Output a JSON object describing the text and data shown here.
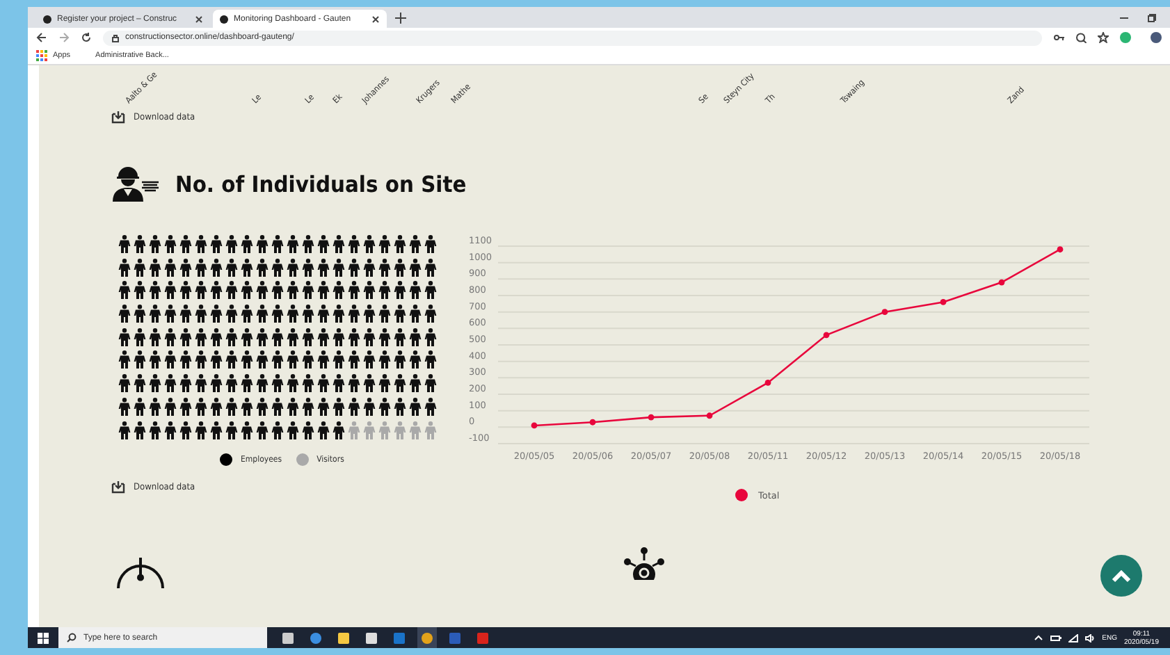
{
  "browser": {
    "tabs": [
      {
        "title": "Register your project – Construc",
        "selected": false
      },
      {
        "title": "Monitoring Dashboard - Gauten",
        "selected": true
      }
    ],
    "url": "constructionsector.online/dashboard-gauteng/",
    "bookmarks": [
      "Apps",
      "Administrative Back..."
    ]
  },
  "top_axis_labels": [
    "Aalto & Ge",
    "Le",
    "Le",
    "Ek",
    "Johannes",
    "Krugers",
    "Mathe",
    "Se",
    "Steyn City",
    "Th",
    "Tswaing",
    "Zand"
  ],
  "download_top": "Download data",
  "section_title": "No. of Individuals on Site",
  "waffle": {
    "rows": [
      {
        "figures": [
          {
            "kind": "employee"
          },
          {
            "kind": "employee"
          },
          {
            "kind": "employee"
          },
          {
            "kind": "employee"
          },
          {
            "kind": "employee"
          },
          {
            "kind": "employee"
          },
          {
            "kind": "employee"
          },
          {
            "kind": "employee"
          },
          {
            "kind": "employee"
          },
          {
            "kind": "employee"
          },
          {
            "kind": "employee"
          },
          {
            "kind": "employee"
          },
          {
            "kind": "employee"
          },
          {
            "kind": "employee"
          },
          {
            "kind": "employee"
          },
          {
            "kind": "employee"
          },
          {
            "kind": "employee"
          },
          {
            "kind": "employee"
          },
          {
            "kind": "employee"
          },
          {
            "kind": "employee"
          },
          {
            "kind": "employee"
          }
        ]
      },
      {
        "figures": [
          {
            "kind": "employee"
          },
          {
            "kind": "employee"
          },
          {
            "kind": "employee"
          },
          {
            "kind": "employee"
          },
          {
            "kind": "employee"
          },
          {
            "kind": "employee"
          },
          {
            "kind": "employee"
          },
          {
            "kind": "employee"
          },
          {
            "kind": "employee"
          },
          {
            "kind": "employee"
          },
          {
            "kind": "employee"
          },
          {
            "kind": "employee"
          },
          {
            "kind": "employee"
          },
          {
            "kind": "employee"
          },
          {
            "kind": "employee"
          },
          {
            "kind": "employee"
          },
          {
            "kind": "employee"
          },
          {
            "kind": "employee"
          },
          {
            "kind": "employee"
          },
          {
            "kind": "employee"
          },
          {
            "kind": "employee"
          }
        ]
      },
      {
        "figures": [
          {
            "kind": "employee"
          },
          {
            "kind": "employee"
          },
          {
            "kind": "employee"
          },
          {
            "kind": "employee"
          },
          {
            "kind": "employee"
          },
          {
            "kind": "employee"
          },
          {
            "kind": "employee"
          },
          {
            "kind": "employee"
          },
          {
            "kind": "employee"
          },
          {
            "kind": "employee"
          },
          {
            "kind": "employee"
          },
          {
            "kind": "employee"
          },
          {
            "kind": "employee"
          },
          {
            "kind": "employee"
          },
          {
            "kind": "employee"
          },
          {
            "kind": "employee"
          },
          {
            "kind": "employee"
          },
          {
            "kind": "employee"
          },
          {
            "kind": "employee"
          },
          {
            "kind": "employee"
          },
          {
            "kind": "employee"
          }
        ]
      },
      {
        "figures": [
          {
            "kind": "employee"
          },
          {
            "kind": "employee"
          },
          {
            "kind": "employee"
          },
          {
            "kind": "employee"
          },
          {
            "kind": "employee"
          },
          {
            "kind": "employee"
          },
          {
            "kind": "employee"
          },
          {
            "kind": "employee"
          },
          {
            "kind": "employee"
          },
          {
            "kind": "employee"
          },
          {
            "kind": "employee"
          },
          {
            "kind": "employee"
          },
          {
            "kind": "employee"
          },
          {
            "kind": "employee"
          },
          {
            "kind": "employee"
          },
          {
            "kind": "employee"
          },
          {
            "kind": "employee"
          },
          {
            "kind": "employee"
          },
          {
            "kind": "employee"
          },
          {
            "kind": "employee"
          },
          {
            "kind": "employee"
          }
        ]
      },
      {
        "figures": [
          {
            "kind": "employee"
          },
          {
            "kind": "employee"
          },
          {
            "kind": "employee"
          },
          {
            "kind": "employee"
          },
          {
            "kind": "employee"
          },
          {
            "kind": "employee"
          },
          {
            "kind": "employee"
          },
          {
            "kind": "employee"
          },
          {
            "kind": "employee"
          },
          {
            "kind": "employee"
          },
          {
            "kind": "employee"
          },
          {
            "kind": "employee"
          },
          {
            "kind": "employee"
          },
          {
            "kind": "employee"
          },
          {
            "kind": "employee"
          },
          {
            "kind": "employee"
          },
          {
            "kind": "employee"
          },
          {
            "kind": "employee"
          },
          {
            "kind": "employee"
          },
          {
            "kind": "employee"
          },
          {
            "kind": "employee"
          }
        ]
      },
      {
        "figures": [
          {
            "kind": "employee"
          },
          {
            "kind": "employee"
          },
          {
            "kind": "employee"
          },
          {
            "kind": "employee"
          },
          {
            "kind": "employee"
          },
          {
            "kind": "employee"
          },
          {
            "kind": "employee"
          },
          {
            "kind": "employee"
          },
          {
            "kind": "employee"
          },
          {
            "kind": "employee"
          },
          {
            "kind": "employee"
          },
          {
            "kind": "employee"
          },
          {
            "kind": "employee"
          },
          {
            "kind": "employee"
          },
          {
            "kind": "employee"
          },
          {
            "kind": "employee"
          },
          {
            "kind": "employee"
          },
          {
            "kind": "employee"
          },
          {
            "kind": "employee"
          },
          {
            "kind": "employee"
          },
          {
            "kind": "employee"
          }
        ]
      },
      {
        "figures": [
          {
            "kind": "employee"
          },
          {
            "kind": "employee"
          },
          {
            "kind": "employee"
          },
          {
            "kind": "employee"
          },
          {
            "kind": "employee"
          },
          {
            "kind": "employee"
          },
          {
            "kind": "employee"
          },
          {
            "kind": "employee"
          },
          {
            "kind": "employee"
          },
          {
            "kind": "employee"
          },
          {
            "kind": "employee"
          },
          {
            "kind": "employee"
          },
          {
            "kind": "employee"
          },
          {
            "kind": "employee"
          },
          {
            "kind": "employee"
          },
          {
            "kind": "employee"
          },
          {
            "kind": "employee"
          },
          {
            "kind": "employee"
          },
          {
            "kind": "employee"
          },
          {
            "kind": "employee"
          },
          {
            "kind": "employee"
          }
        ]
      },
      {
        "figures": [
          {
            "kind": "employee"
          },
          {
            "kind": "employee"
          },
          {
            "kind": "employee"
          },
          {
            "kind": "employee"
          },
          {
            "kind": "employee"
          },
          {
            "kind": "employee"
          },
          {
            "kind": "employee"
          },
          {
            "kind": "employee"
          },
          {
            "kind": "employee"
          },
          {
            "kind": "employee"
          },
          {
            "kind": "employee"
          },
          {
            "kind": "employee"
          },
          {
            "kind": "employee"
          },
          {
            "kind": "employee"
          },
          {
            "kind": "employee"
          },
          {
            "kind": "employee"
          },
          {
            "kind": "employee"
          },
          {
            "kind": "employee"
          },
          {
            "kind": "employee"
          },
          {
            "kind": "employee"
          },
          {
            "kind": "employee"
          }
        ]
      },
      {
        "figures": [
          {
            "kind": "employee"
          },
          {
            "kind": "employee"
          },
          {
            "kind": "employee"
          },
          {
            "kind": "employee"
          },
          {
            "kind": "employee"
          },
          {
            "kind": "employee"
          },
          {
            "kind": "employee"
          },
          {
            "kind": "employee"
          },
          {
            "kind": "employee"
          },
          {
            "kind": "employee"
          },
          {
            "kind": "employee"
          },
          {
            "kind": "employee"
          },
          {
            "kind": "employee"
          },
          {
            "kind": "employee"
          },
          {
            "kind": "employee"
          },
          {
            "kind": "visitor"
          },
          {
            "kind": "visitor"
          },
          {
            "kind": "visitor"
          },
          {
            "kind": "visitor"
          },
          {
            "kind": "visitor"
          },
          {
            "kind": "visitor"
          }
        ]
      }
    ],
    "legend": [
      {
        "label": "Employees",
        "color": "#000000"
      },
      {
        "label": "Visitors",
        "color": "#a9a9a9"
      }
    ]
  },
  "download_bottom": "Download data",
  "chart_data": {
    "type": "line",
    "categories": [
      "20/05/05",
      "20/05/06",
      "20/05/07",
      "20/05/08",
      "20/05/11",
      "20/05/12",
      "20/05/13",
      "20/05/14",
      "20/05/15",
      "20/05/18"
    ],
    "series": [
      {
        "name": "Total",
        "color": "#e8063c",
        "marker": "circle",
        "values": [
          10,
          30,
          60,
          70,
          270,
          560,
          700,
          760,
          880,
          1080
        ]
      }
    ],
    "grid": true,
    "ylim": [
      -100,
      1100
    ],
    "yticks": [
      -100,
      0,
      100,
      200,
      300,
      400,
      500,
      600,
      700,
      800,
      900,
      1000,
      1100
    ]
  },
  "taskbar": {
    "search_placeholder": "Type here to search",
    "language": "ENG",
    "time": "09:11",
    "date": "2020/05/19"
  }
}
